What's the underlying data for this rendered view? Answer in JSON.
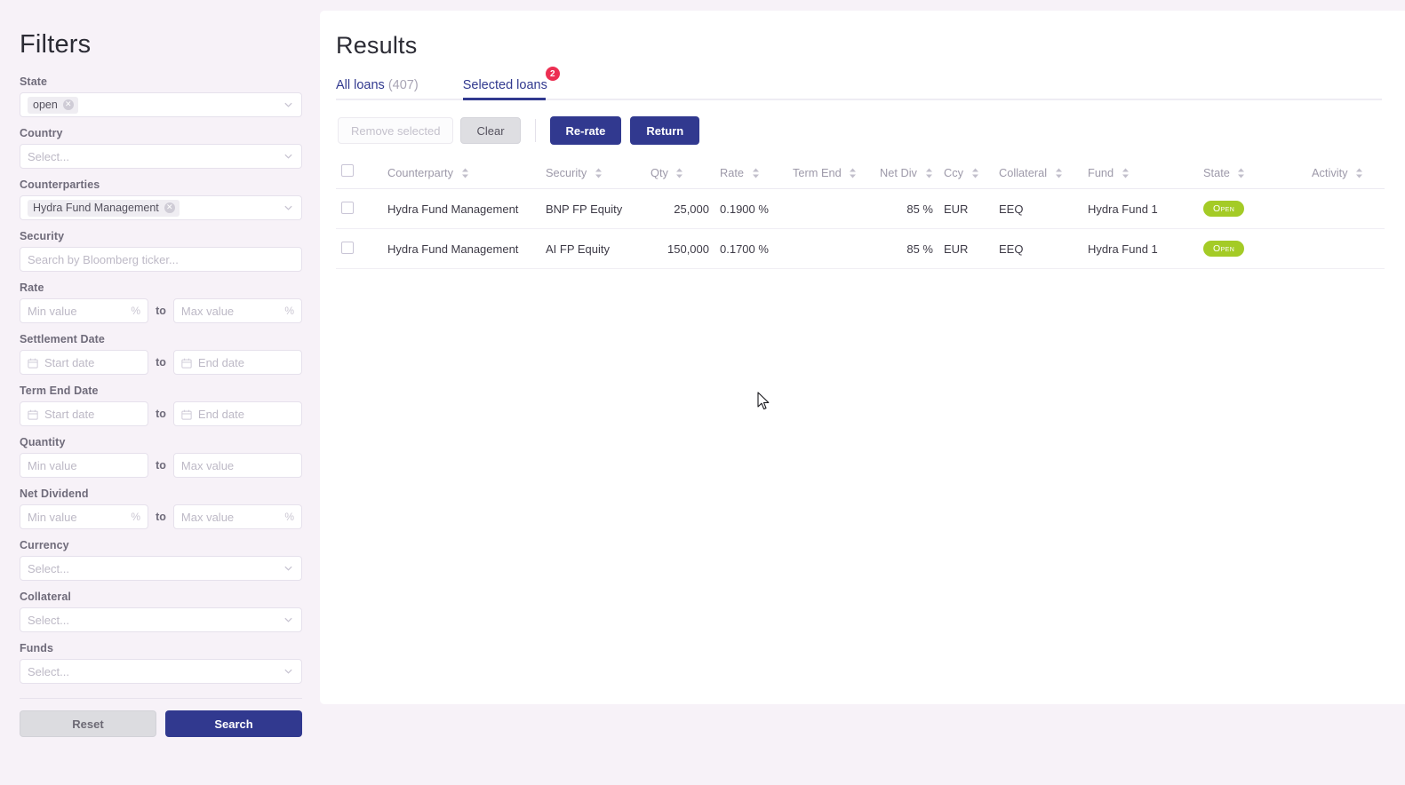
{
  "sidebar": {
    "title": "Filters",
    "fields": [
      {
        "label": "State",
        "type": "select-chips",
        "chips": [
          "open"
        ]
      },
      {
        "label": "Country",
        "type": "select",
        "placeholder": "Select..."
      },
      {
        "label": "Counterparties",
        "type": "select-chips",
        "chips": [
          "Hydra Fund Management"
        ]
      },
      {
        "label": "Security",
        "type": "text",
        "placeholder": "Search by Bloomberg ticker..."
      },
      {
        "label": "Rate",
        "type": "range-pct",
        "min_placeholder": "Min value",
        "max_placeholder": "Max value",
        "to": "to",
        "suffix": "%"
      },
      {
        "label": "Settlement Date",
        "type": "range-date",
        "min_placeholder": "Start date",
        "max_placeholder": "End date",
        "to": "to"
      },
      {
        "label": "Term End Date",
        "type": "range-date",
        "min_placeholder": "Start date",
        "max_placeholder": "End date",
        "to": "to"
      },
      {
        "label": "Quantity",
        "type": "range",
        "min_placeholder": "Min value",
        "max_placeholder": "Max value",
        "to": "to"
      },
      {
        "label": "Net Dividend",
        "type": "range-pct",
        "min_placeholder": "Min value",
        "max_placeholder": "Max value",
        "to": "to",
        "suffix": "%"
      },
      {
        "label": "Currency",
        "type": "select",
        "placeholder": "Select..."
      },
      {
        "label": "Collateral",
        "type": "select",
        "placeholder": "Select..."
      },
      {
        "label": "Funds",
        "type": "select",
        "placeholder": "Select..."
      }
    ],
    "reset_label": "Reset",
    "search_label": "Search"
  },
  "main": {
    "title": "Results",
    "tabs": [
      {
        "label": "All loans",
        "count": "(407)",
        "active": false,
        "badge": null
      },
      {
        "label": "Selected loans",
        "count": "",
        "active": true,
        "badge": "2"
      }
    ],
    "actions": {
      "remove_selected": "Remove selected",
      "clear": "Clear",
      "re_rate": "Re-rate",
      "return": "Return"
    },
    "table": {
      "columns": [
        {
          "key": "check",
          "label": "",
          "sortable": false,
          "align": "left"
        },
        {
          "key": "counterparty",
          "label": "Counterparty",
          "sortable": true,
          "align": "left"
        },
        {
          "key": "security",
          "label": "Security",
          "sortable": true,
          "align": "left"
        },
        {
          "key": "qty",
          "label": "Qty",
          "sortable": true,
          "align": "right"
        },
        {
          "key": "rate",
          "label": "Rate",
          "sortable": true,
          "align": "left"
        },
        {
          "key": "term_end",
          "label": "Term End",
          "sortable": true,
          "align": "left"
        },
        {
          "key": "net_div",
          "label": "Net Div",
          "sortable": true,
          "align": "right"
        },
        {
          "key": "ccy",
          "label": "Ccy",
          "sortable": true,
          "align": "left"
        },
        {
          "key": "collateral",
          "label": "Collateral",
          "sortable": true,
          "align": "left"
        },
        {
          "key": "fund",
          "label": "Fund",
          "sortable": true,
          "align": "left"
        },
        {
          "key": "state",
          "label": "State",
          "sortable": true,
          "align": "left"
        },
        {
          "key": "activity",
          "label": "Activity",
          "sortable": true,
          "align": "left"
        }
      ],
      "rows": [
        {
          "checked": false,
          "counterparty": "Hydra Fund Management",
          "security": "BNP FP Equity",
          "qty": "25,000",
          "rate": "0.1900 %",
          "term_end": "",
          "net_div": "85 %",
          "ccy": "EUR",
          "collateral": "EEQ",
          "fund": "Hydra Fund 1",
          "state": "Open",
          "activity": ""
        },
        {
          "checked": false,
          "counterparty": "Hydra Fund Management",
          "security": "AI FP Equity",
          "qty": "150,000",
          "rate": "0.1700 %",
          "term_end": "",
          "net_div": "85 %",
          "ccy": "EUR",
          "collateral": "EEQ",
          "fund": "Hydra Fund 1",
          "state": "Open",
          "activity": ""
        }
      ]
    }
  },
  "colors": {
    "page_background": "#f7f2f8",
    "panel_background": "#ffffff",
    "primary": "#31398f",
    "badge_notification": "#ec2f52",
    "badge_open": "#a4cb26",
    "label_text": "#6f6b7a",
    "placeholder_text": "#bdb9c6"
  }
}
